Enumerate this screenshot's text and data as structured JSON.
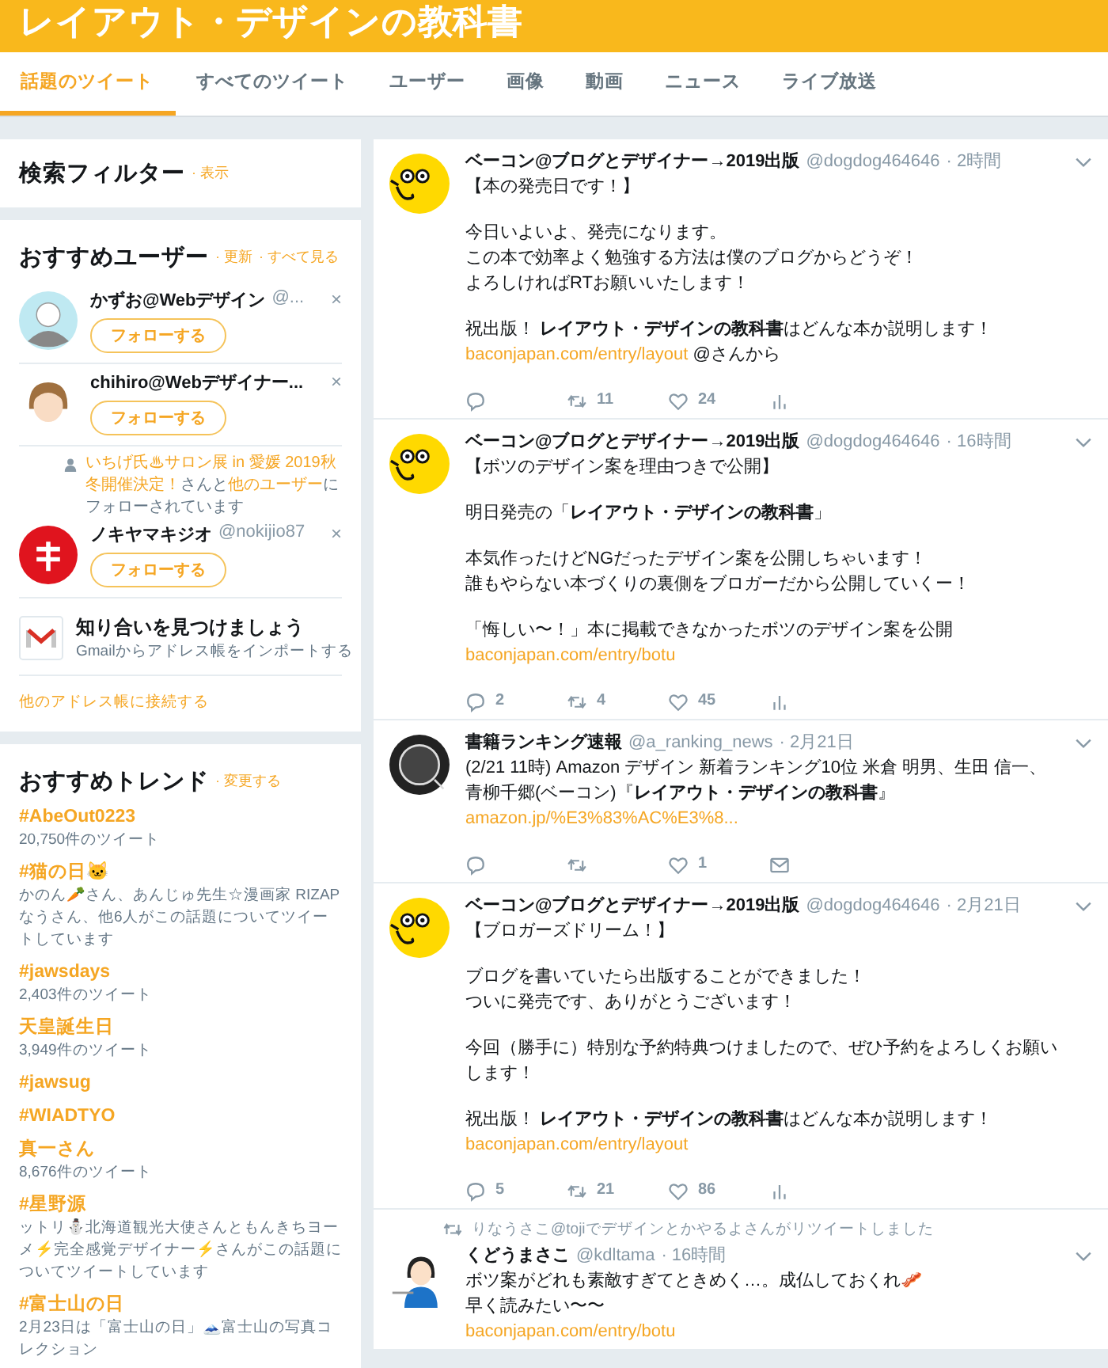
{
  "header": {
    "title": "レイアウト・デザインの教科書"
  },
  "tabs": [
    {
      "label": "話題のツイート",
      "selected": true
    },
    {
      "label": "すべてのツイート",
      "selected": false
    },
    {
      "label": "ユーザー",
      "selected": false
    },
    {
      "label": "画像",
      "selected": false
    },
    {
      "label": "動画",
      "selected": false
    },
    {
      "label": "ニュース",
      "selected": false
    },
    {
      "label": "ライブ放送",
      "selected": false
    }
  ],
  "search_filter": {
    "title": "検索フィルター",
    "link": "· 表示"
  },
  "who_to_follow": {
    "title": "おすすめユーザー",
    "links": [
      "· 更新",
      "· すべて見る"
    ],
    "users": [
      {
        "kind": "man",
        "name": "かずお@Webデザイン",
        "handle": "@...",
        "follow": "フォローする",
        "close": "×"
      },
      {
        "kind": "woman",
        "name": "chihiro@Webデザイナー...",
        "follow": "フォローする",
        "close": "×"
      },
      {
        "kind": "badge",
        "name": "ノキヤマキジオ",
        "handle": "@nokijio87",
        "follow": "フォローする",
        "close": "×",
        "context": [
          {
            "kind": "link",
            "text": "いちげ氏♨サロン展 in 愛媛 2019秋冬開催決定！"
          },
          {
            "kind": "text",
            "text": "さんと"
          },
          {
            "kind": "link",
            "text": "他のユーザー"
          },
          {
            "kind": "text",
            "text": "にフォローされています"
          }
        ]
      }
    ],
    "find_friends": {
      "title": "知り合いを見つけましょう",
      "subtitle": "Gmailからアドレス帳をインポートする"
    },
    "connect_link": "他のアドレス帳に接続する"
  },
  "trends": {
    "title": "おすすめトレンド",
    "link": "· 変更する",
    "items": [
      {
        "name": "#AbeOut0223",
        "desc": "20,750件のツイート"
      },
      {
        "name": "#猫の日🐱",
        "desc": "かのん🥕さん、あんじゅ先生☆漫画家 RIZAPなうさん、他6人がこの話題についてツイートしています"
      },
      {
        "name": "#jawsdays",
        "desc": "2,403件のツイート"
      },
      {
        "name": "天皇誕生日",
        "desc": "3,949件のツイート"
      },
      {
        "name": "#jawsug"
      },
      {
        "name": "#WIADTYO"
      },
      {
        "name": "真一さん",
        "desc": "8,676件のツイート"
      },
      {
        "name": "#星野源",
        "desc": "ットリ⛄北海道観光大使さんともんきちヨーメ⚡完全感覚デザイナー⚡さんがこの話題についてツイートしています"
      },
      {
        "name": "#富士山の日",
        "desc": "2月23日は「富士山の日」🗻富士山の写真コレクション"
      }
    ]
  },
  "tweets": [
    {
      "kind": "bacon",
      "name": "ベーコン@ブログとデザイナー→2019出版",
      "handle": "@dogdog464646",
      "time": "· 2時間",
      "paragraphs": [
        [
          {
            "text": "【本の発売日です！】"
          }
        ],
        [
          {
            "text": "今日いよいよ、発売になります。"
          },
          {
            "text": "この本で効率よく勉強する方法は僕のブログからどうぞ！"
          },
          {
            "text": "よろしければRTお願いいたします！"
          }
        ],
        [
          {
            "text": "祝出版！ **レイアウト・デザインの教科書**はどんな本か説明します！"
          },
          {
            "link": "baconjapan.com/entry/layout",
            "text": " @さんから"
          }
        ]
      ],
      "actions": [
        {
          "kind": "reply"
        },
        {
          "kind": "retweet",
          "count": "11"
        },
        {
          "kind": "like",
          "count": "24"
        },
        {
          "kind": "stats"
        }
      ]
    },
    {
      "kind": "bacon",
      "name": "ベーコン@ブログとデザイナー→2019出版",
      "handle": "@dogdog464646",
      "time": "· 16時間",
      "paragraphs": [
        [
          {
            "text": "【ボツのデザイン案を理由つきで公開】"
          }
        ],
        [
          {
            "text": "明日発売の「**レイアウト・デザインの教科書**」"
          }
        ],
        [
          {
            "text": "本気作ったけどNGだったデザイン案を公開しちゃいます！"
          },
          {
            "text": "誰もやらない本づくりの裏側をブロガーだから公開していくー！"
          }
        ],
        [
          {
            "text": "「悔しい〜！」本に掲載できなかったボツのデザイン案を公開"
          },
          {
            "link": "baconjapan.com/entry/botu"
          }
        ]
      ],
      "actions": [
        {
          "kind": "reply",
          "count": "2"
        },
        {
          "kind": "retweet",
          "count": "4"
        },
        {
          "kind": "like",
          "count": "45"
        },
        {
          "kind": "stats"
        }
      ]
    },
    {
      "kind": "ring",
      "name": "書籍ランキング速報",
      "handle": "@a_ranking_news",
      "time": "· 2月21日",
      "paragraphs": [
        [
          {
            "text": "(2/21 11時) Amazon デザイン 新着ランキング10位 米倉 明男、生田 信一、青柳千郷(ベーコン)『**レイアウト・デザインの教科書**』"
          },
          {
            "link": "amazon.jp/%E3%83%AC%E3%8..."
          }
        ]
      ],
      "actions": [
        {
          "kind": "reply"
        },
        {
          "kind": "retweet"
        },
        {
          "kind": "like",
          "count": "1"
        },
        {
          "kind": "mail"
        }
      ]
    },
    {
      "kind": "bacon",
      "name": "ベーコン@ブログとデザイナー→2019出版",
      "handle": "@dogdog464646",
      "time": "· 2月21日",
      "paragraphs": [
        [
          {
            "text": "【ブロガーズドリーム！】"
          }
        ],
        [
          {
            "text": "ブログを書いていたら出版することができました！"
          },
          {
            "text": "ついに発売です、ありがとうございます！"
          }
        ],
        [
          {
            "text": "今回（勝手に）特別な予約特典つけましたので、ぜひ予約をよろしくお願いします！"
          }
        ],
        [
          {
            "text": "祝出版！ **レイアウト・デザインの教科書**はどんな本か説明します！"
          },
          {
            "link": "baconjapan.com/entry/layout"
          }
        ]
      ],
      "actions": [
        {
          "kind": "reply",
          "count": "5"
        },
        {
          "kind": "retweet",
          "count": "21"
        },
        {
          "kind": "like",
          "count": "86"
        },
        {
          "kind": "stats"
        }
      ]
    },
    {
      "kind": "person",
      "retweeted_by": "りなうさこ@tojiでデザインとかやるよさんがリツイートしました",
      "name": "くどうまさこ",
      "handle": "@kdltama",
      "time": "· 16時間",
      "paragraphs": [
        [
          {
            "text": "ボツ案がどれも素敵すぎてときめく…。成仏しておくれ🥓"
          },
          {
            "text": "早く読みたい〜〜"
          },
          {
            "link": "baconjapan.com/entry/botu"
          }
        ]
      ]
    }
  ]
}
